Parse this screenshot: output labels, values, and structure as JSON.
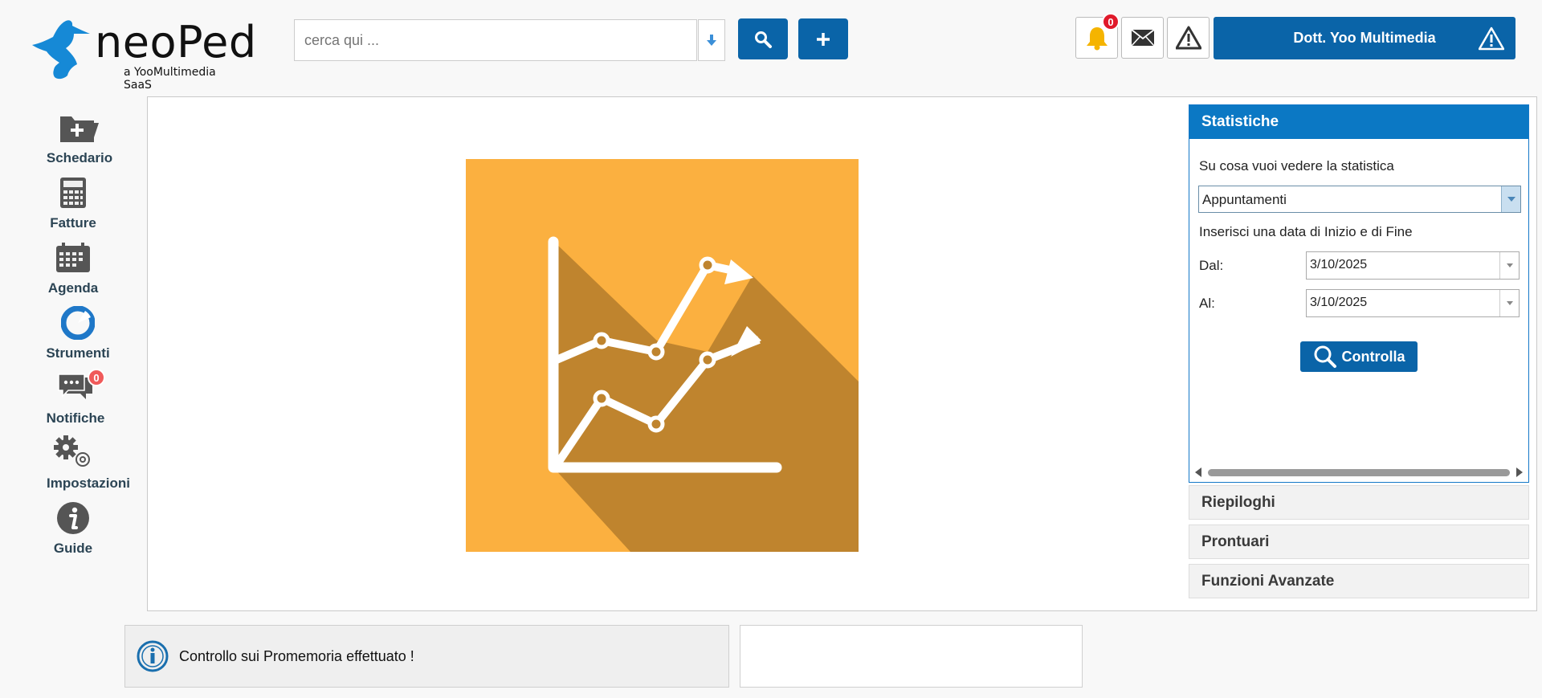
{
  "header": {
    "brand": "neoPed",
    "tagline": "a YooMultimedia SaaS",
    "search_placeholder": "cerca qui ...",
    "notifications_count": "0",
    "user_name": "Dott. Yoo Multimedia",
    "accent_color": "#0a64a8"
  },
  "sidebar": {
    "items": [
      {
        "label": "Schedario",
        "icon": "folder-add-icon"
      },
      {
        "label": "Fatture",
        "icon": "calculator-icon"
      },
      {
        "label": "Agenda",
        "icon": "calendar-icon"
      },
      {
        "label": "Strumenti",
        "icon": "pie-chart-icon"
      },
      {
        "label": "Notifiche",
        "icon": "chat-icon",
        "badge": "0"
      },
      {
        "label": "Impostazioni",
        "icon": "gears-icon"
      },
      {
        "label": "Guide",
        "icon": "info-icon"
      }
    ]
  },
  "stats": {
    "title": "Statistiche",
    "question": "Su cosa vuoi vedere la statistica",
    "selected": "Appuntamenti",
    "date_prompt": "Inserisci una data di Inizio e di Fine",
    "from_label": "Dal:",
    "from_value": "3/10/2025",
    "to_label": "Al:",
    "to_value": "3/10/2025",
    "check_button": "Controlla"
  },
  "accordion": [
    "Riepiloghi",
    "Prontuari",
    "Funzioni Avanzate"
  ],
  "toast": {
    "message": "Controllo sui Promemoria effettuato !"
  }
}
